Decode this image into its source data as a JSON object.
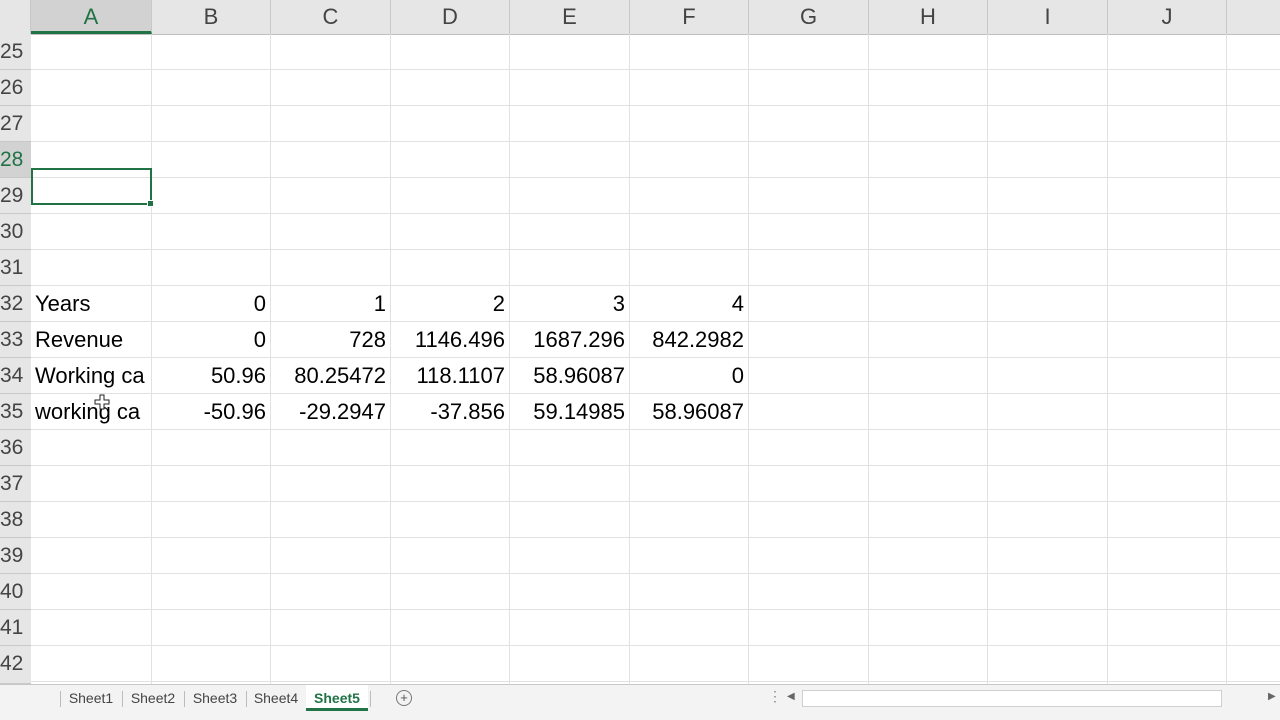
{
  "columns": [
    "A",
    "B",
    "C",
    "D",
    "E",
    "F",
    "G",
    "H",
    "I",
    "J"
  ],
  "selected_column": "A",
  "row_numbers": [
    "25",
    "26",
    "27",
    "28",
    "29",
    "30",
    "31",
    "32",
    "33",
    "34",
    "35",
    "36",
    "37",
    "38",
    "39",
    "40",
    "41",
    "42"
  ],
  "selected_row": "28",
  "rows": {
    "r32": {
      "a": "Years",
      "b": "0",
      "c": "1",
      "d": "2",
      "e": "3",
      "f": "4"
    },
    "r33": {
      "a": "Revenue",
      "b": "0",
      "c": "728",
      "d": "1146.496",
      "e": "1687.296",
      "f": "842.2982"
    },
    "r34": {
      "a": "Working ca",
      "b": "50.96",
      "c": "80.25472",
      "d": "118.1107",
      "e": "58.96087",
      "f": "0"
    },
    "r35": {
      "a": "working ca",
      "b": "-50.96",
      "c": "-29.2947",
      "d": "-37.856",
      "e": "59.14985",
      "f": "58.96087"
    }
  },
  "sheet_tabs": [
    "Sheet1",
    "Sheet2",
    "Sheet3",
    "Sheet4",
    "Sheet5"
  ],
  "active_tab": "Sheet5",
  "add_sheet_label": "+",
  "colors": {
    "accent": "#217346",
    "header_bg": "#e6e6e6",
    "grid": "#e1e1e1"
  }
}
